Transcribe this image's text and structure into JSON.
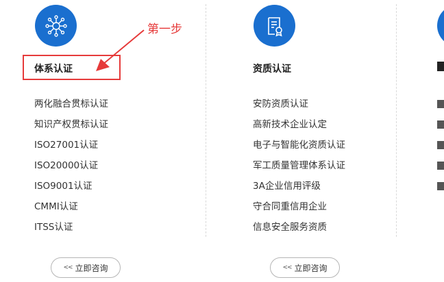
{
  "annotation": {
    "step_label": "第一步"
  },
  "columns": [
    {
      "title": "体系认证",
      "icon": "network-nodes-icon",
      "items": [
        "两化融合贯标认证",
        "知识产权贯标认证",
        "ISO27001认证",
        "ISO20000认证",
        "ISO9001认证",
        "CMMI认证",
        "ITSS认证"
      ],
      "button_label": "立即咨询"
    },
    {
      "title": "资质认证",
      "icon": "certificate-icon",
      "items": [
        "安防资质认证",
        "高新技术企业认定",
        "电子与智能化资质认证",
        "军工质量管理体系认证",
        "3A企业信用评级",
        "守合同重信用企业",
        "信息安全服务资质"
      ],
      "button_label": "立即咨询"
    }
  ],
  "colors": {
    "accent_blue": "#1a6fcf",
    "annotation_red": "#e63a3a"
  }
}
